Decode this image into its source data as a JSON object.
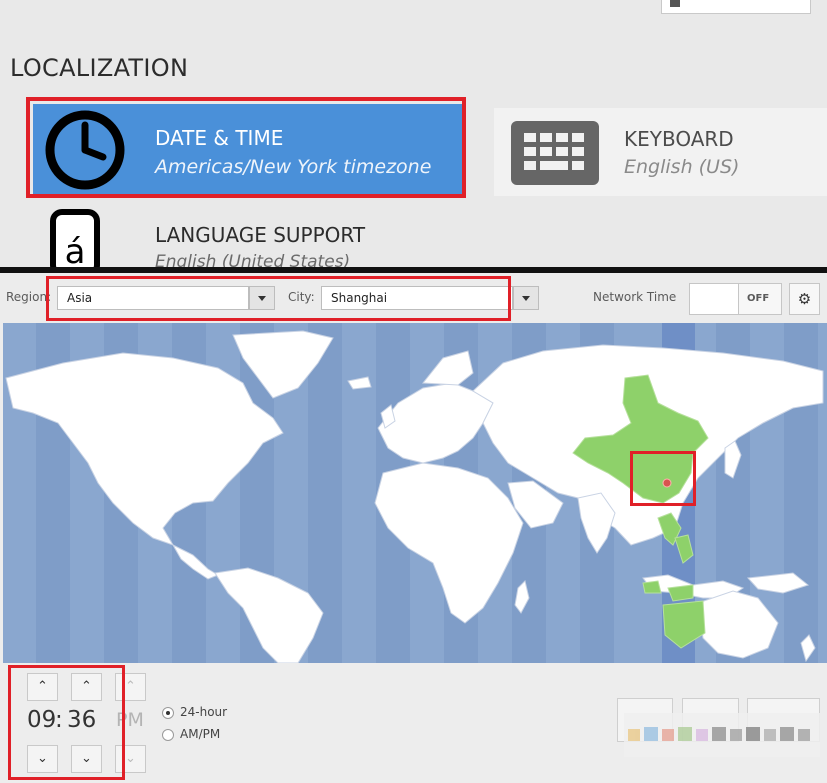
{
  "localization": {
    "section_title": "LOCALIZATION",
    "date_time": {
      "name": "DATE & TIME",
      "status": "Americas/New York timezone",
      "icon": "clock-icon",
      "tile_color": "#4a90d9"
    },
    "keyboard": {
      "name": "KEYBOARD",
      "status": "English (US)",
      "icon": "keyboard-icon"
    },
    "language_support": {
      "name": "LANGUAGE SUPPORT",
      "status": "English (United States)",
      "icon": "language-icon"
    }
  },
  "datetime": {
    "region_label": "Region:",
    "region_value": "Asia",
    "city_label": "City:",
    "city_value": "Shanghai",
    "network_time_label": "Network Time",
    "network_time_state": "OFF",
    "settings_icon": "gear-icon",
    "map": {
      "ocean_color": "#8aa7cf",
      "land_color": "#ffffff",
      "region_highlight_color": "#8ed16a",
      "selected_timezone_band_color": "#6f8fc6",
      "selected_city": "Shanghai"
    },
    "time": {
      "hours": "09",
      "separator": ":",
      "minutes": "36",
      "ampm": "PM"
    },
    "format_options": [
      {
        "label": "24-hour",
        "selected": true
      },
      {
        "label": "AM/PM",
        "selected": false
      }
    ],
    "highlight_color": "#e02028"
  }
}
